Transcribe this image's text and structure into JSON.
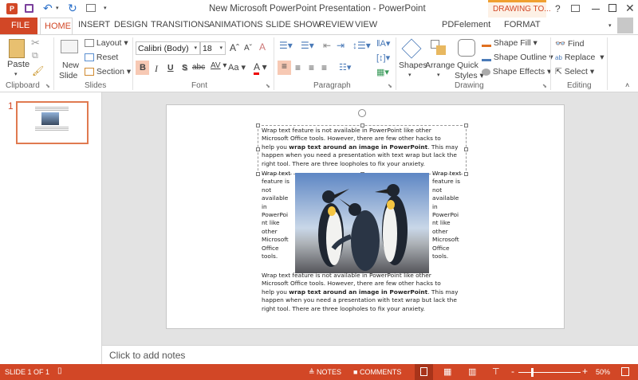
{
  "window": {
    "title": "New Microsoft PowerPoint Presentation - PowerPoint",
    "contextual_tab_group": "DRAWING TO...",
    "accent": "#d24726"
  },
  "tabs": [
    "FILE",
    "HOME",
    "INSERT",
    "DESIGN",
    "TRANSITIONS",
    "ANIMATIONS",
    "SLIDE SHOW",
    "REVIEW",
    "VIEW",
    "PDFelement",
    "FORMAT"
  ],
  "active_tab": "HOME",
  "ribbon": {
    "clipboard": {
      "label": "Clipboard",
      "paste": "Paste"
    },
    "slides": {
      "label": "Slides",
      "new_slide_1": "New",
      "new_slide_2": "Slide",
      "layout": "Layout",
      "reset": "Reset",
      "section": "Section"
    },
    "font": {
      "label": "Font",
      "font_name": "Calibri (Body)",
      "font_size": "18",
      "bold": "B",
      "italic": "I",
      "underline": "U",
      "shadow": "S",
      "strike": "abc",
      "spacing": "AV",
      "case": "Aa",
      "color": "A"
    },
    "paragraph": {
      "label": "Paragraph"
    },
    "drawing": {
      "label": "Drawing",
      "shapes": "Shapes",
      "arrange": "Arrange",
      "quick_1": "Quick",
      "quick_2": "Styles",
      "shape_fill": "Shape Fill",
      "shape_outline": "Shape Outline",
      "shape_effects": "Shape Effects"
    },
    "editing": {
      "label": "Editing",
      "find": "Find",
      "replace": "Replace",
      "select": "Select"
    }
  },
  "thumbnail": {
    "number": "1"
  },
  "slide": {
    "para_lines": [
      "Wrap text feature is not available in PowerPoint like other",
      "Microsoft Office  tools. However, there are few other hacks to"
    ],
    "bold_line": {
      "pre": "help you ",
      "bold": "wrap text around an image in PowerPoint",
      "post": ". This may"
    },
    "para_tail": [
      "happen when you need a presentation with text wrap but lack the",
      "right tool. There are three loopholes to fix your anxiety."
    ],
    "column_lines": [
      "Wrap text",
      "feature is",
      "not",
      "available",
      "in",
      "PowerPoi",
      "nt like",
      "other",
      "Microsoft",
      "Office",
      "tools."
    ]
  },
  "notes_placeholder": "Click to add notes",
  "status": {
    "slide": "SLIDE 1 OF 1",
    "notes": "NOTES",
    "comments": "COMMENTS",
    "zoom": "50%",
    "zoom_level": 50
  }
}
